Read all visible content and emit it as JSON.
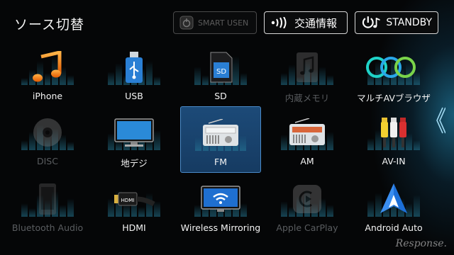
{
  "header": {
    "title": "ソース切替",
    "smart_usen": "SMART USEN",
    "traffic_info": "交通情報",
    "standby": "STANDBY"
  },
  "sources": [
    {
      "label": "iPhone",
      "icon": "music-note-icon",
      "enabled": true
    },
    {
      "label": "USB",
      "icon": "usb-drive-icon",
      "enabled": true
    },
    {
      "label": "SD",
      "icon": "sd-card-icon",
      "enabled": true
    },
    {
      "label": "内蔵メモリ",
      "icon": "internal-memory-icon",
      "enabled": false
    },
    {
      "label": "マルチAVブラウザ",
      "icon": "multi-av-browser-icon",
      "enabled": true
    },
    {
      "label": "DISC",
      "icon": "disc-icon",
      "enabled": false
    },
    {
      "label": "地デジ",
      "icon": "tv-icon",
      "enabled": true
    },
    {
      "label": "FM",
      "icon": "fm-radio-icon",
      "enabled": true,
      "selected": true
    },
    {
      "label": "AM",
      "icon": "am-radio-icon",
      "enabled": true
    },
    {
      "label": "AV-IN",
      "icon": "rca-cable-icon",
      "enabled": true
    },
    {
      "label": "Bluetooth Audio",
      "icon": "bluetooth-phone-icon",
      "enabled": false
    },
    {
      "label": "HDMI",
      "icon": "hdmi-cable-icon",
      "enabled": true
    },
    {
      "label": "Wireless Mirroring",
      "icon": "wireless-mirroring-icon",
      "enabled": true
    },
    {
      "label": "Apple CarPlay",
      "icon": "carplay-icon",
      "enabled": false
    },
    {
      "label": "Android Auto",
      "icon": "android-auto-icon",
      "enabled": true
    }
  ],
  "watermark": "Response.",
  "colors": {
    "accent": "#2a6aa8",
    "selected_bg": "#1c4a78",
    "disabled_text": "#5a5d60"
  }
}
